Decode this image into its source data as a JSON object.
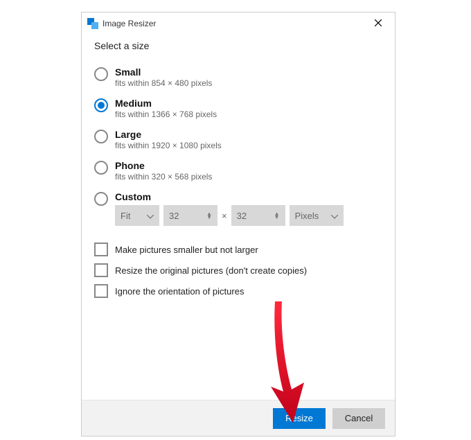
{
  "title": "Image Resizer",
  "heading": "Select a size",
  "options": [
    {
      "label": "Small",
      "desc": "fits within 854 × 480 pixels",
      "selected": false
    },
    {
      "label": "Medium",
      "desc": "fits within 1366 × 768 pixels",
      "selected": true
    },
    {
      "label": "Large",
      "desc": "fits within 1920 × 1080 pixels",
      "selected": false
    },
    {
      "label": "Phone",
      "desc": "fits within 320 × 568 pixels",
      "selected": false
    },
    {
      "label": "Custom",
      "desc": "",
      "selected": false
    }
  ],
  "custom": {
    "mode": "Fit",
    "width": "32",
    "height": "32",
    "unit": "Pixels",
    "times": "×"
  },
  "checks": [
    {
      "label": "Make pictures smaller but not larger",
      "checked": false
    },
    {
      "label": "Resize the original pictures (don't create copies)",
      "checked": false
    },
    {
      "label": "Ignore the orientation of pictures",
      "checked": false
    }
  ],
  "buttons": {
    "primary": "Resize",
    "secondary": "Cancel"
  }
}
